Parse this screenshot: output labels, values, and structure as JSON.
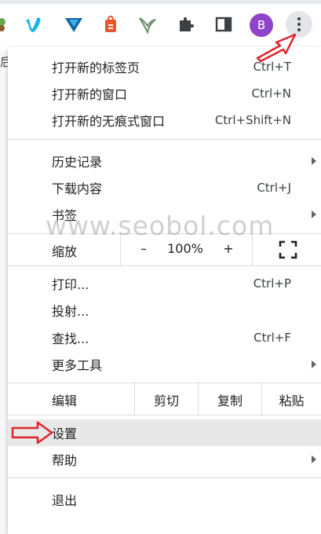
{
  "toolbar": {
    "icons": [
      "extension-leaf-icon",
      "vimeo-icon",
      "vivaldi-icon",
      "anchor-tag-icon",
      "bird-icon",
      "puzzle-extensions-icon",
      "sidepanel-icon"
    ],
    "avatar_letter": "B",
    "page_fragment": "后"
  },
  "menu": {
    "group1": [
      {
        "label": "打开新的标签页",
        "shortcut": "Ctrl+T"
      },
      {
        "label": "打开新的窗口",
        "shortcut": "Ctrl+N"
      },
      {
        "label": "打开新的无痕式窗口",
        "shortcut": "Ctrl+Shift+N"
      }
    ],
    "group2": [
      {
        "label": "历史记录",
        "shortcut": ""
      },
      {
        "label": "下载内容",
        "shortcut": "Ctrl+J"
      },
      {
        "label": "书签",
        "shortcut": ""
      }
    ],
    "zoom": {
      "label": "缩放",
      "minus": "–",
      "value": "100%",
      "plus": "+"
    },
    "group3": [
      {
        "label": "打印...",
        "shortcut": "Ctrl+P"
      },
      {
        "label": "投射...",
        "shortcut": ""
      },
      {
        "label": "查找...",
        "shortcut": "Ctrl+F"
      },
      {
        "label": "更多工具",
        "shortcut": ""
      }
    ],
    "edit": {
      "label": "编辑",
      "cut": "剪切",
      "copy": "复制",
      "paste": "粘贴"
    },
    "group4": [
      {
        "label": "设置"
      },
      {
        "label": "帮助"
      }
    ],
    "exit": {
      "label": "退出"
    }
  },
  "watermark": "www.seobol.com",
  "colors": {
    "accent_arrow": "#e0242c",
    "avatar": "#8e44c9",
    "hover": "#e8e8e8"
  }
}
